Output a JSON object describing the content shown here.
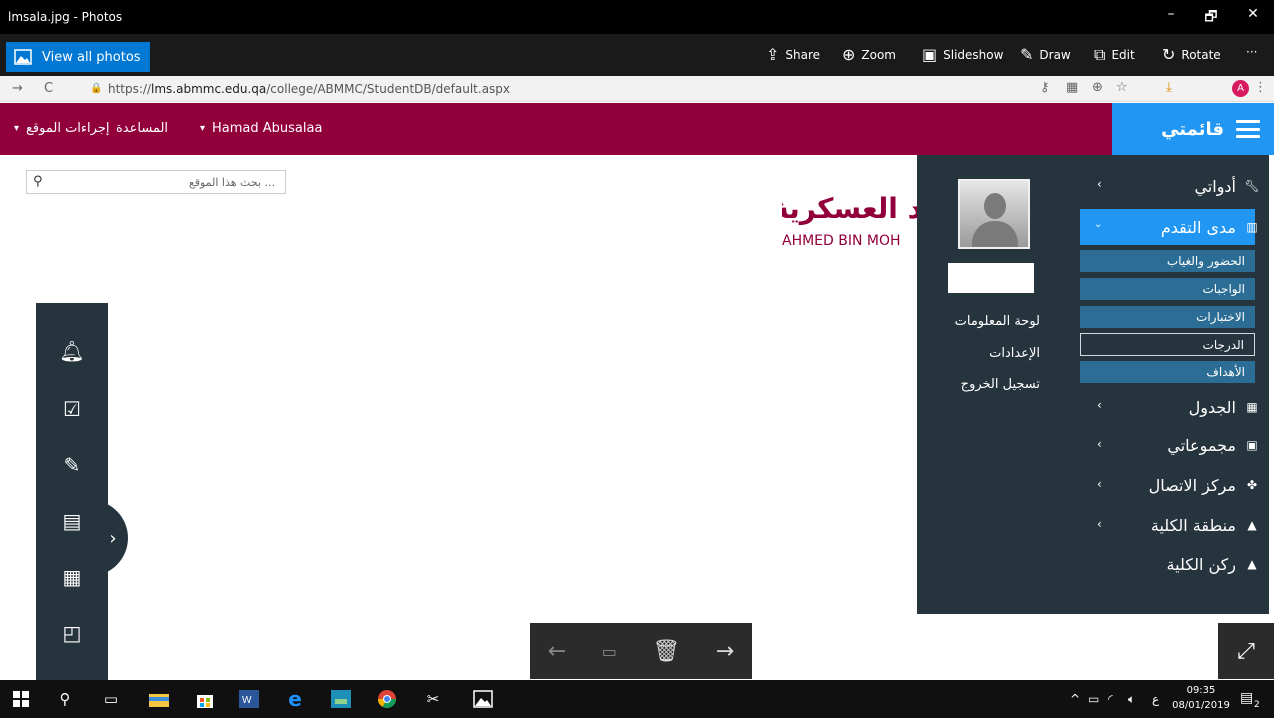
{
  "window": {
    "title": "lmsala.jpg - Photos",
    "minimize": "–",
    "restore": "🗗",
    "close": "✕"
  },
  "photos_toolbar": {
    "view_all": "View all photos",
    "share": "Share",
    "zoom": "Zoom",
    "slideshow": "Slideshow",
    "draw": "Draw",
    "edit": "Edit",
    "rotate": "Rotate",
    "more": "···",
    "icons": {
      "share": "share-icon",
      "zoom": "zoom-icon",
      "slideshow": "slideshow-icon",
      "draw": "draw-icon",
      "edit": "edit-icon",
      "rotate": "rotate-icon"
    }
  },
  "browser": {
    "url_prefix": "https://",
    "url_host": "lms.abmmc.edu.qa",
    "url_path": "/college/ABMMC/StudentDB/default.aspx",
    "profile_initial": "A"
  },
  "site_header": {
    "menu_label": "قائمتي",
    "site_actions": "إجراءات الموقع",
    "help": "المساعدة",
    "user": "Hamad Abusalaa",
    "color": "#92003b",
    "menu_color": "#2196f3"
  },
  "search": {
    "placeholder": "بحث هذا الموقع ..."
  },
  "logo": {
    "arabic": "د العسكرية",
    "english": "AHMED BIN MOH"
  },
  "profile_menu": {
    "dashboard": "لوحة المعلومات",
    "settings": "الإعدادات",
    "logout": "تسجيل الخروج"
  },
  "nav": {
    "tools": "أدواتي",
    "progress": "مدى التقدم",
    "sub_items": [
      "الحضور والغياب",
      "الواجبات",
      "الاختبارات",
      "الدرجات",
      "الأهداف"
    ],
    "selected_sub": "الدرجات",
    "schedule": "الجدول",
    "groups": "مجموعاتي",
    "contact_center": "مركز الاتصال",
    "college_zone": "منطقة الكلية",
    "college_corner": "ركن الكلية"
  },
  "taskbar": {
    "time": "09:35",
    "date": "08/01/2019",
    "lang": "ع",
    "notifications": "2"
  }
}
